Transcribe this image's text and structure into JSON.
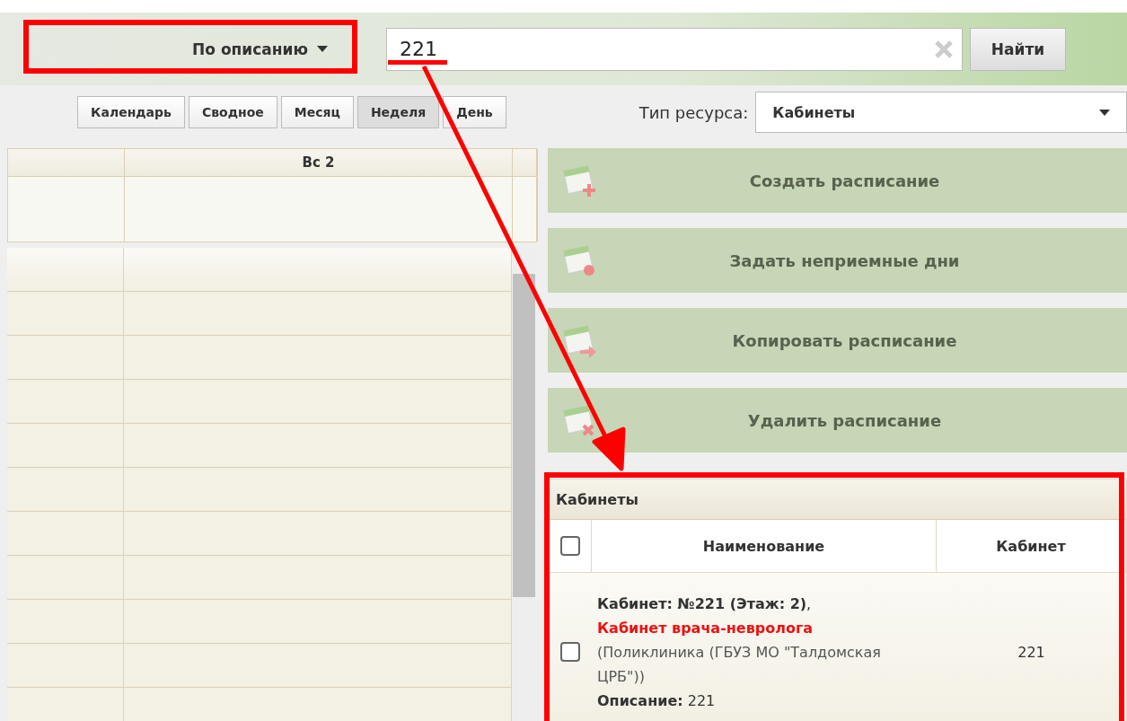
{
  "search": {
    "mode": "По описанию",
    "value": "221",
    "find_button": "Найти"
  },
  "views": [
    {
      "label": "Календарь",
      "selected": false
    },
    {
      "label": "Сводное",
      "selected": false
    },
    {
      "label": "Месяц",
      "selected": false
    },
    {
      "label": "Неделя",
      "selected": true
    },
    {
      "label": "День",
      "selected": false
    }
  ],
  "resource_type": {
    "label": "Тип ресурса:",
    "value": "Кабинеты"
  },
  "calendar": {
    "day_header": "Вс 2"
  },
  "actions": [
    {
      "label": "Создать расписание",
      "kind": "create",
      "disabled": true
    },
    {
      "label": "Задать неприемные дни",
      "kind": "block",
      "disabled": true
    },
    {
      "label": "Копировать расписание",
      "kind": "copy",
      "disabled": true
    },
    {
      "label": "Удалить расписание",
      "kind": "delete",
      "disabled": true
    }
  ],
  "rooms": {
    "title": "Кабинеты",
    "select_all_checked": false,
    "columns": [
      "Наименование",
      "Кабинет"
    ],
    "rows": [
      {
        "checked": false,
        "room": "**Кабинет: №221 (Этаж: 2)**,",
        "name": "Кабинет врача-невролога",
        "organization": "(Поликлиника (ГБУЗ МО \"Талдомская ЦРБ\"))",
        "description": "**Описание:** 221",
        "number": "221"
      }
    ]
  }
}
